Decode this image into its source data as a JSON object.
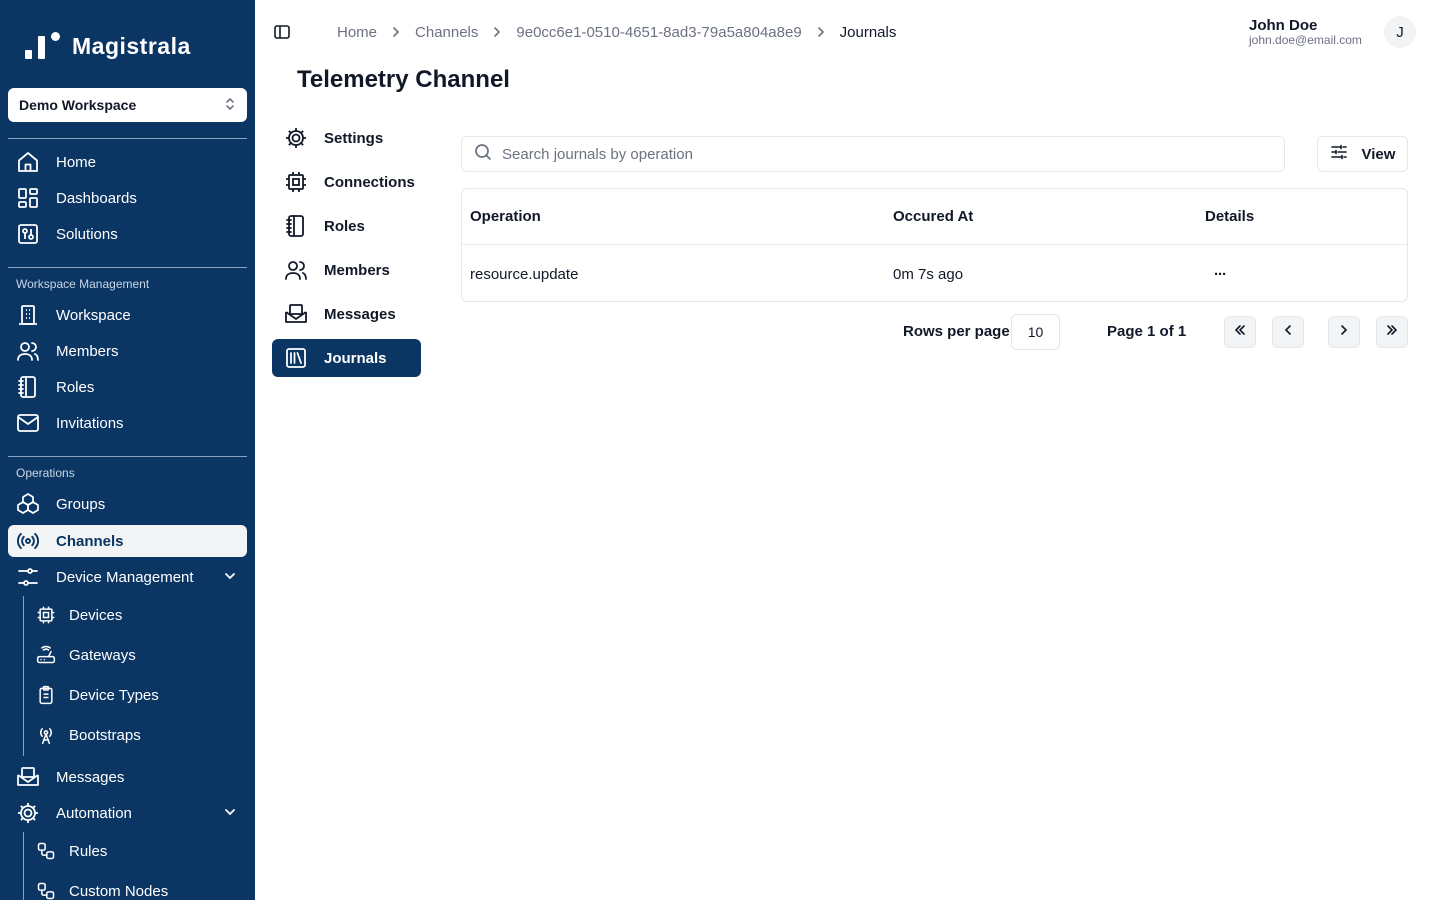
{
  "brand": {
    "name": "Magistrala"
  },
  "workspace_select": {
    "value": "Demo Workspace"
  },
  "sidebar": {
    "primary": [
      {
        "label": "Home",
        "icon": "home-icon"
      },
      {
        "label": "Dashboards",
        "icon": "dashboard-icon"
      },
      {
        "label": "Solutions",
        "icon": "solutions-icon"
      }
    ],
    "workspace_section": "Workspace Management",
    "workspace_items": [
      {
        "label": "Workspace",
        "icon": "building-icon"
      },
      {
        "label": "Members",
        "icon": "users-icon"
      },
      {
        "label": "Roles",
        "icon": "notebook-icon"
      },
      {
        "label": "Invitations",
        "icon": "mail-icon"
      }
    ],
    "operations_section": "Operations",
    "operations_items": [
      {
        "label": "Groups",
        "icon": "boxes-icon"
      },
      {
        "label": "Channels",
        "icon": "broadcast-icon",
        "active": true
      },
      {
        "label": "Device Management",
        "icon": "sliders-icon",
        "expanded": true
      }
    ],
    "device_sub": [
      {
        "label": "Devices",
        "icon": "cpu-icon"
      },
      {
        "label": "Gateways",
        "icon": "router-icon"
      },
      {
        "label": "Device Types",
        "icon": "clipboard-icon"
      },
      {
        "label": "Bootstraps",
        "icon": "antenna-icon"
      }
    ],
    "messages": {
      "label": "Messages",
      "icon": "mail-open-icon"
    },
    "automation": {
      "label": "Automation",
      "icon": "gear-icon",
      "expanded": true
    },
    "automation_sub": [
      {
        "label": "Rules",
        "icon": "workflow-icon"
      },
      {
        "label": "Custom Nodes",
        "icon": "workflow-icon"
      }
    ]
  },
  "breadcrumb": {
    "items": [
      "Home",
      "Channels",
      "9e0cc6e1-0510-4651-8ad3-79a5a804a8e9"
    ],
    "current": "Journals"
  },
  "user": {
    "name": "John Doe",
    "email": "john.doe@email.com",
    "avatar_initial": "J"
  },
  "page_title": "Telemetry Channel",
  "channel_nav": [
    {
      "label": "Settings",
      "icon": "gear-icon"
    },
    {
      "label": "Connections",
      "icon": "cpu-icon"
    },
    {
      "label": "Roles",
      "icon": "notebook-icon"
    },
    {
      "label": "Members",
      "icon": "users-icon"
    },
    {
      "label": "Messages",
      "icon": "mail-open-icon"
    },
    {
      "label": "Journals",
      "icon": "library-icon",
      "active": true
    }
  ],
  "search": {
    "placeholder": "Search journals by operation",
    "value": ""
  },
  "view_button": {
    "label": "View"
  },
  "table": {
    "columns": [
      "Operation",
      "Occured At",
      "Details"
    ],
    "rows": [
      {
        "operation": "resource.update",
        "occurred_at": "0m 7s ago",
        "details": "···"
      }
    ]
  },
  "pagination": {
    "rows_label": "Rows per page",
    "rows_value": "10",
    "page_info": "Page 1 of 1"
  },
  "colors": {
    "sidebar_bg": "#0b3563",
    "active_bg": "#0b3563",
    "border": "#e5e7eb"
  }
}
